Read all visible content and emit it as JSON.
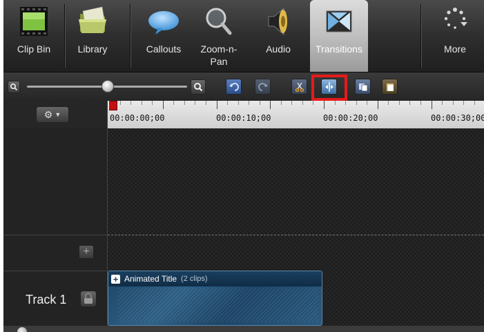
{
  "tabs": [
    {
      "name": "clip-bin",
      "label": "Clip Bin",
      "icon": "film-thumbnail-icon"
    },
    {
      "name": "library",
      "label": "Library",
      "icon": "folder-icon"
    },
    {
      "name": "callouts",
      "label": "Callouts",
      "icon": "speech-bubble-icon"
    },
    {
      "name": "zoom-n-pan",
      "label": "Zoom-n-\nPan",
      "icon": "magnifier-icon"
    },
    {
      "name": "audio",
      "label": "Audio",
      "icon": "speaker-icon"
    },
    {
      "name": "transitions",
      "label": "Transitions",
      "icon": "transitions-icon",
      "active": true
    },
    {
      "name": "more",
      "label": "More",
      "icon": "more-dots-icon"
    }
  ],
  "toolbar": {
    "buttons": [
      "zoom-out",
      "zoom-in",
      "undo",
      "redo",
      "cut",
      "split",
      "copy",
      "paste"
    ]
  },
  "timeline": {
    "timecodes": [
      "00:00:00;00",
      "00:00:10;00",
      "00:00:20;00",
      "00:00:30;00"
    ]
  },
  "tracks": [
    {
      "label": "Track 1"
    }
  ],
  "clip": {
    "title": "Animated Title",
    "subtitle": "(2 clips)"
  },
  "colors": {
    "highlight": "#e51b1b",
    "clip": "#2f6289",
    "active_tab": "#bfbfbf"
  }
}
